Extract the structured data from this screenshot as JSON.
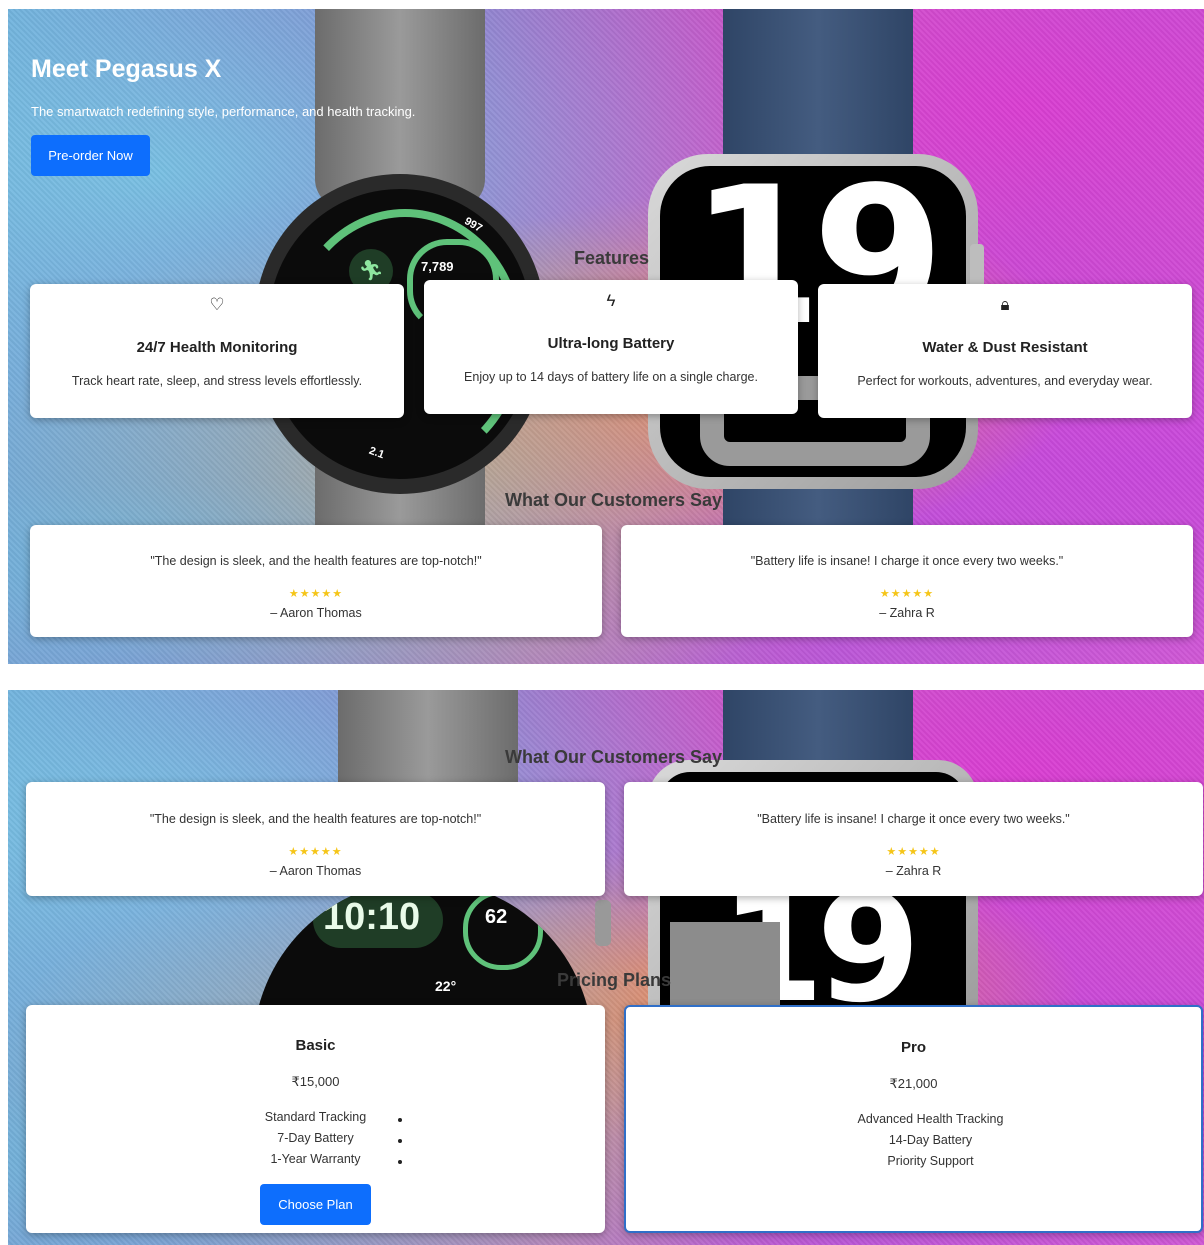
{
  "hero": {
    "title": "Meet Pegasus X",
    "subtitle": "The smartwatch redefining style, performance, and health tracking.",
    "cta_label": "Pre-order Now"
  },
  "watch_faces": {
    "left_top": {
      "steps": "7,789",
      "metric": "997",
      "distance": "2.1"
    },
    "right_top": {
      "digits": "19"
    },
    "left_bottom": {
      "time": "10:10",
      "heart_rate": "62",
      "temp": "22°"
    },
    "right_bottom": {
      "digits": "19"
    }
  },
  "features": {
    "title": "Features",
    "items": [
      {
        "icon": "heart-icon",
        "glyph": "♡",
        "title": "24/7 Health Monitoring",
        "text": "Track heart rate, sleep, and stress levels effortlessly."
      },
      {
        "icon": "lightning-icon",
        "glyph": "ϟ",
        "title": "Ultra-long Battery",
        "text": "Enjoy up to 14 days of battery life on a single charge."
      },
      {
        "icon": "lock-icon",
        "glyph": "🔒︎",
        "title": "Water & Dust Resistant",
        "text": "Perfect for workouts, adventures, and everyday wear."
      }
    ]
  },
  "testimonials": {
    "title": "What Our Customers Say",
    "items": [
      {
        "quote": "\"The design is sleek, and the health features are top-notch!\"",
        "stars": "★★★★★",
        "rating": 5,
        "author": "– Aaron Thomas"
      },
      {
        "quote": "\"Battery life is insane! I charge it once every two weeks.\"",
        "stars": "★★★★★",
        "rating": 5,
        "author": "– Zahra R"
      }
    ]
  },
  "pricing": {
    "title": "Pricing Plans",
    "plans": [
      {
        "name": "Basic",
        "price": "₹15,000",
        "features": [
          "Standard Tracking",
          "7-Day Battery",
          "1-Year Warranty"
        ],
        "cta_label": "Choose Plan"
      },
      {
        "name": "Pro",
        "price": "₹21,000",
        "features": [
          "Advanced Health Tracking",
          "14-Day Battery",
          "Priority Support"
        ]
      }
    ]
  },
  "colors": {
    "primary": "#0d6efd",
    "star": "#f5c518",
    "highlight_border": "#2f6fc8"
  }
}
